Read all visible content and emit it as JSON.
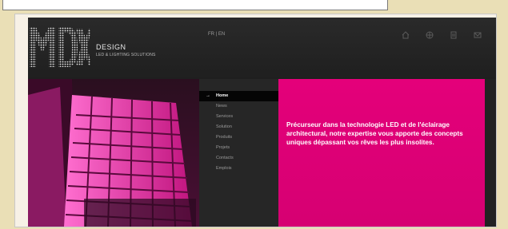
{
  "brand": {
    "name": "DESIGN",
    "tagline": "LED & LIGHTING SOLUTIONS"
  },
  "header": {
    "language_switch": "FR | EN",
    "icons": [
      "home-icon",
      "globe-icon",
      "document-icon",
      "mail-icon"
    ]
  },
  "menu": {
    "items": [
      {
        "label": "Home",
        "active": true
      },
      {
        "label": "News"
      },
      {
        "label": "Services"
      },
      {
        "label": "Solution"
      },
      {
        "label": "Produits"
      },
      {
        "label": "Projets"
      },
      {
        "label": "Contacts"
      },
      {
        "label": "Emplois"
      }
    ]
  },
  "hero": {
    "text": "Précurseur dans la technologie LED et de l'éclairage architectural, notre expertise vous apporte des concepts uniques dépassant vos rêves les plus insolites."
  },
  "colors": {
    "accent": "#e4007a",
    "header_bg": "#222222",
    "page_bg": "#eadfb6"
  }
}
